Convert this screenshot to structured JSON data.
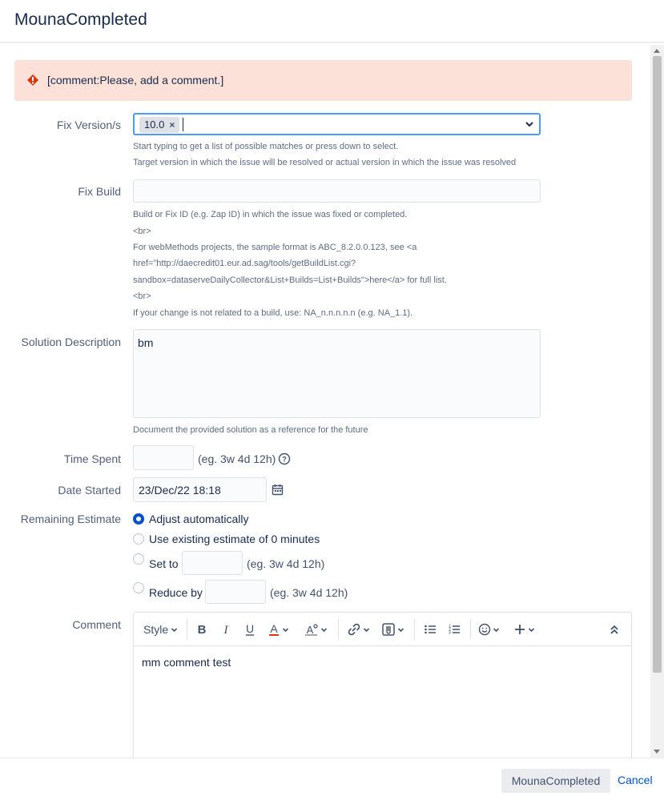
{
  "dialog": {
    "title": "MounaCompleted"
  },
  "error": {
    "message": "[comment:Please, add a comment.]"
  },
  "fix_version": {
    "label": "Fix Version/s",
    "selected": "10.0",
    "remove_glyph": "×",
    "help1": "Start typing to get a list of possible matches or press down to select.",
    "help2": "Target version in which the issue will be resolved or actual version in which the issue was resolved"
  },
  "fix_build": {
    "label": "Fix Build",
    "value": "",
    "help_lines": [
      "Build or Fix ID (e.g. Zap ID) in which the issue was fixed or completed.",
      "<br>",
      "For webMethods projects, the sample format is ABC_8.2.0.0.123, see <a",
      "href=\"http://daecredit01.eur.ad.sag/tools/getBuildList.cgi?",
      "sandbox=dataserveDailyCollector&List+Builds=List+Builds\">here</a> for full list.",
      "<br>",
      "If your change is not related to a build, use: NA_n.n.n.n.n (e.g. NA_1.1)."
    ]
  },
  "solution": {
    "label": "Solution Description",
    "value": "bm",
    "help": "Document the provided solution as a reference for the future"
  },
  "time_spent": {
    "label": "Time Spent",
    "value": "",
    "hint": "(eg. 3w 4d 12h)"
  },
  "date_started": {
    "label": "Date Started",
    "value": "23/Dec/22 18:18"
  },
  "remaining": {
    "label": "Remaining Estimate",
    "options": [
      "Adjust automatically",
      "Use existing estimate of 0 minutes",
      "Set to",
      "Reduce by"
    ],
    "hint": "(eg. 3w 4d 12h)",
    "selected_index": 0
  },
  "comment": {
    "label": "Comment",
    "style_label": "Style",
    "body": "mm comment test"
  },
  "footer": {
    "submit": "MounaCompleted",
    "cancel": "Cancel"
  },
  "colors": {
    "accent": "#0052cc",
    "error_bg": "#fbe1d8",
    "error_icon": "#de350b"
  },
  "icons": [
    "error-icon",
    "chevron-down-icon",
    "help-icon",
    "calendar-icon",
    "bold-icon",
    "italic-icon",
    "underline-icon",
    "text-color-icon",
    "text-style-icon",
    "link-icon",
    "attachment-icon",
    "bullet-list-icon",
    "numbered-list-icon",
    "emoji-icon",
    "plus-icon",
    "collapse-icon"
  ]
}
